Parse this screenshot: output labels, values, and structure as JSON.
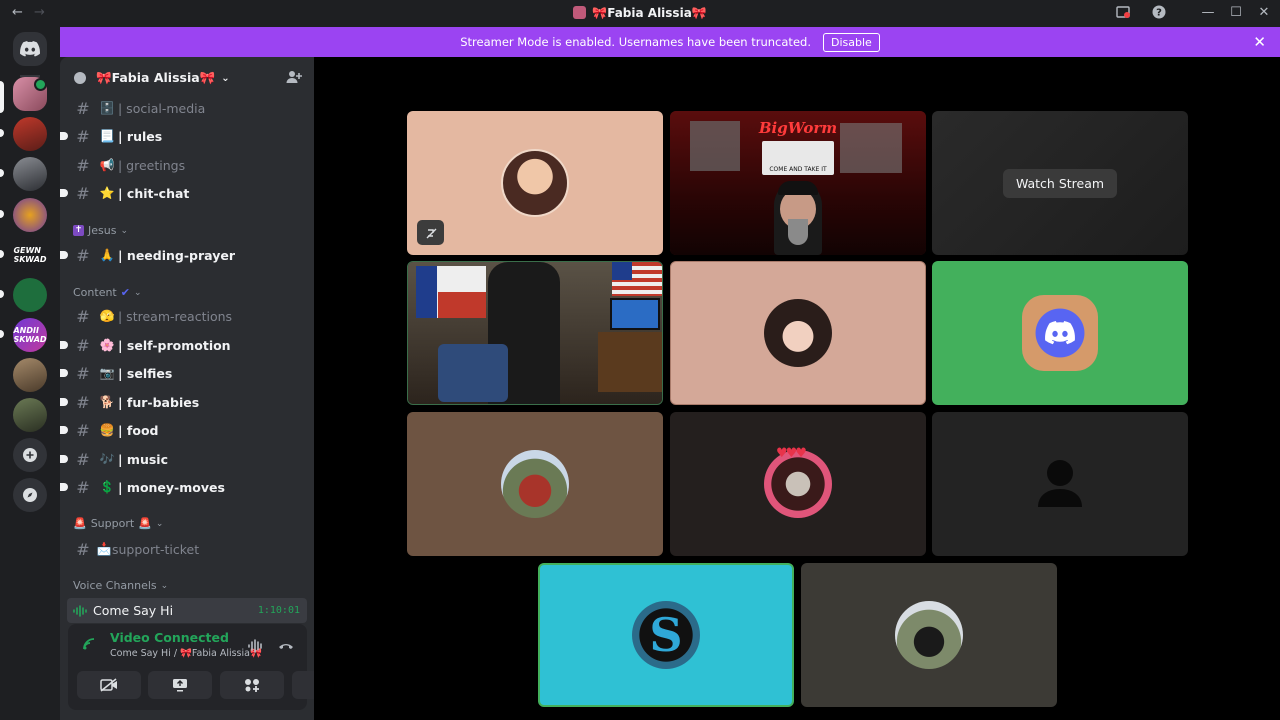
{
  "window": {
    "title": "🎀Fabia Alissia🎀",
    "back_icon": "arrow-left-icon",
    "forward_icon": "arrow-right-icon"
  },
  "banner": {
    "message": "Streamer Mode is enabled. Usernames have been truncated.",
    "disable_label": "Disable"
  },
  "guild": {
    "name": "🎀Fabia Alissia🎀"
  },
  "channels": [
    {
      "emoji": "🗄️",
      "name": "| social-media",
      "unread": false
    },
    {
      "emoji": "📃",
      "name": "| rules",
      "unread": true
    },
    {
      "emoji": "📢",
      "name": "| greetings",
      "unread": false
    },
    {
      "emoji": "⭐",
      "name": "| chit-chat",
      "unread": true
    },
    {
      "emoji": "🙏",
      "name": "| needing-prayer",
      "unread": true
    },
    {
      "emoji": "🫣",
      "name": "| stream-reactions",
      "unread": false
    },
    {
      "emoji": "🌸",
      "name": "| self-promotion",
      "unread": true
    },
    {
      "emoji": "📷",
      "name": "| selfies",
      "unread": true
    },
    {
      "emoji": "🐕",
      "name": "| fur-babies",
      "unread": true
    },
    {
      "emoji": "🍔",
      "name": "| food",
      "unread": true
    },
    {
      "emoji": "🎶",
      "name": "| music",
      "unread": true
    },
    {
      "emoji": "💲",
      "name": "| money-moves",
      "unread": true
    },
    {
      "emoji": "📩",
      "name": "support-ticket",
      "unread": false
    }
  ],
  "categories": {
    "jesus": "Jesus",
    "content": "Content",
    "support": "Support",
    "voice": "Voice Channels"
  },
  "voice_channel": {
    "name": "Come Say Hi",
    "timer": "1:10:01"
  },
  "voice_panel": {
    "status": "Video Connected",
    "location": "Come Say Hi / 🎀Fabia Alissia🎀"
  },
  "stream": {
    "watch_label": "Watch Stream",
    "stream_title": "BigWorm",
    "sign": "COME AND TAKE IT"
  },
  "colors": {
    "accent": "#9b44f2",
    "connected": "#23a55a",
    "tile_pink": "#e4b8a1",
    "tile_green": "#43b05c",
    "tile_cyan": "#2fc1d4"
  }
}
